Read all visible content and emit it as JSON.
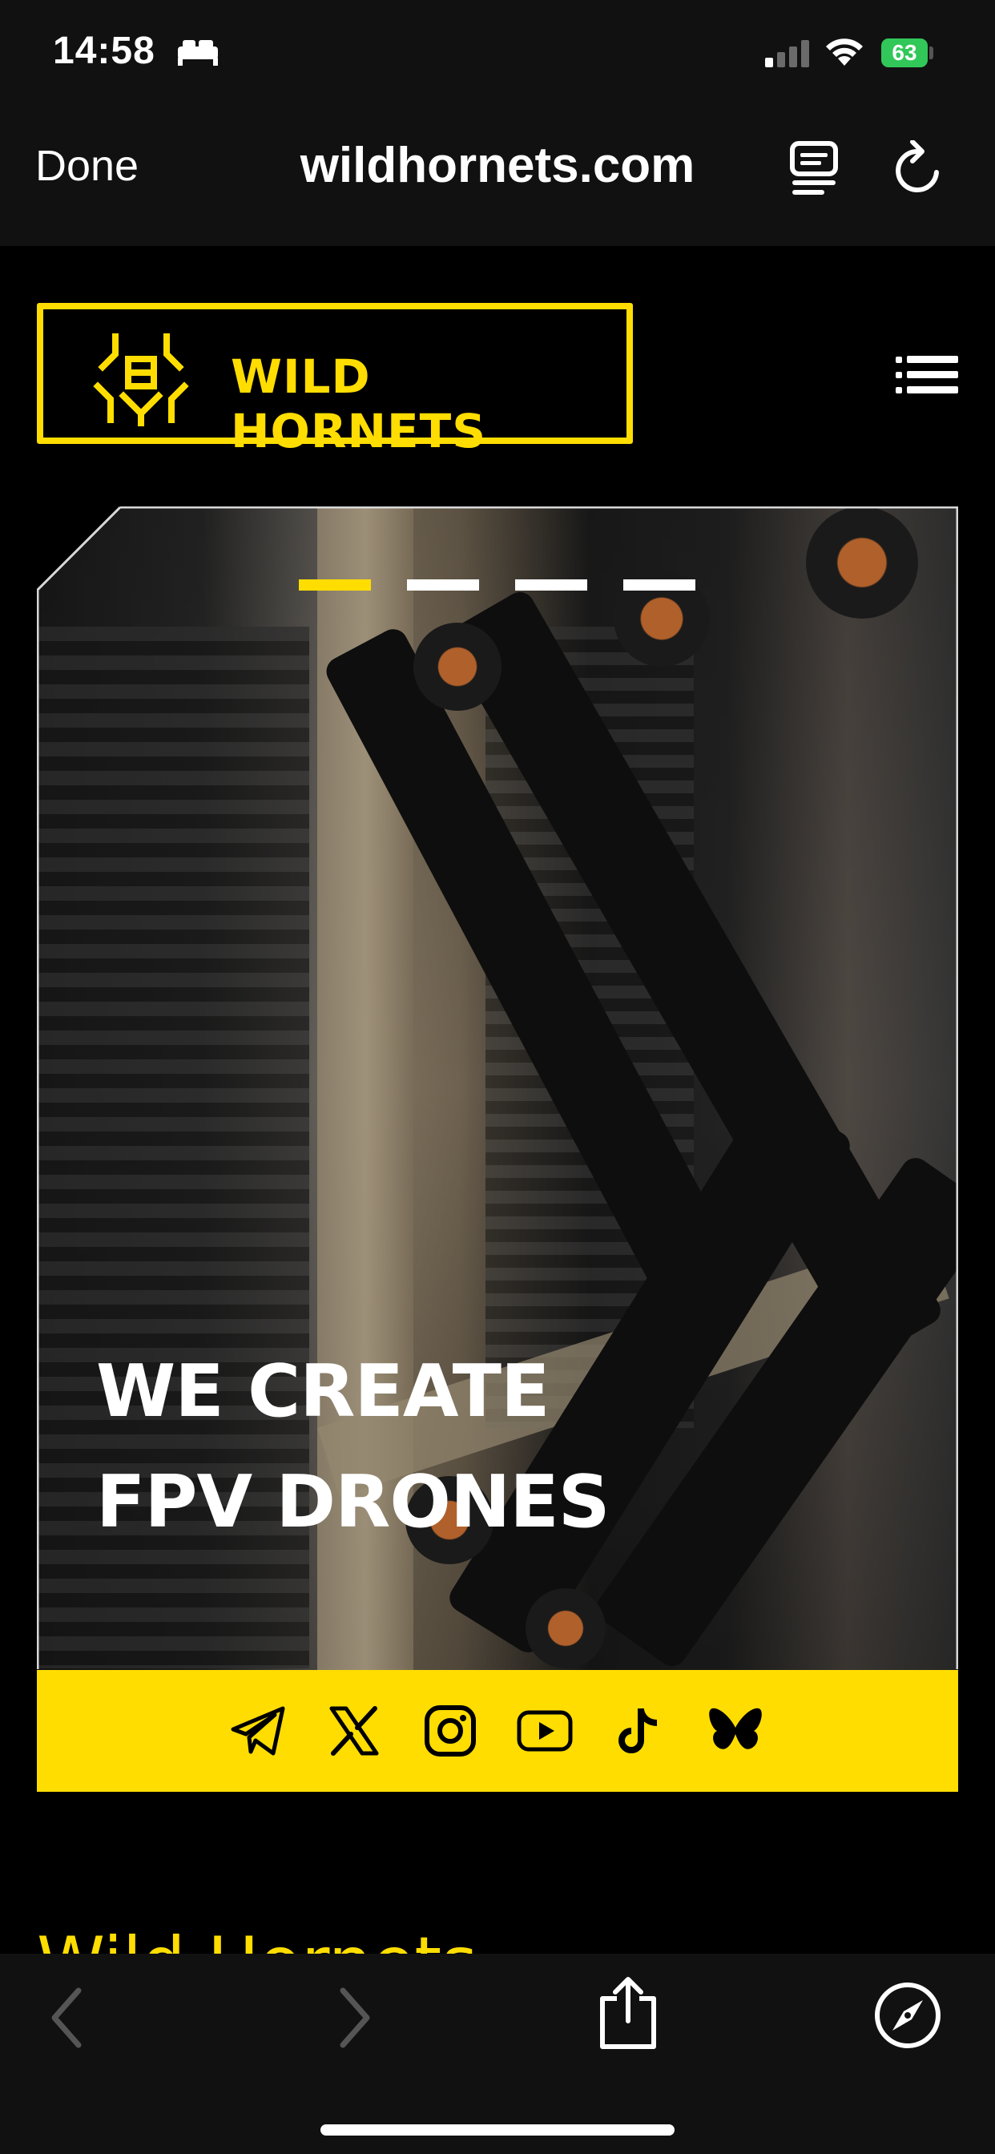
{
  "status_bar": {
    "time": "14:58",
    "battery_level": "63"
  },
  "browser": {
    "done_label": "Done",
    "url": "wildhornets.com"
  },
  "site": {
    "logo_text": "WILD HORNETS",
    "hero": {
      "line1": "WE CREATE",
      "line2": "FPV DRONES",
      "slide_count": 4,
      "active_slide": 1
    },
    "social_links": [
      "telegram-icon",
      "x-icon",
      "instagram-icon",
      "youtube-icon",
      "tiktok-icon",
      "bluesky-icon"
    ],
    "section_heading": "Wild Hornets"
  },
  "colors": {
    "accent": "#ffdd00",
    "background": "#000000",
    "bar": "#111112"
  }
}
